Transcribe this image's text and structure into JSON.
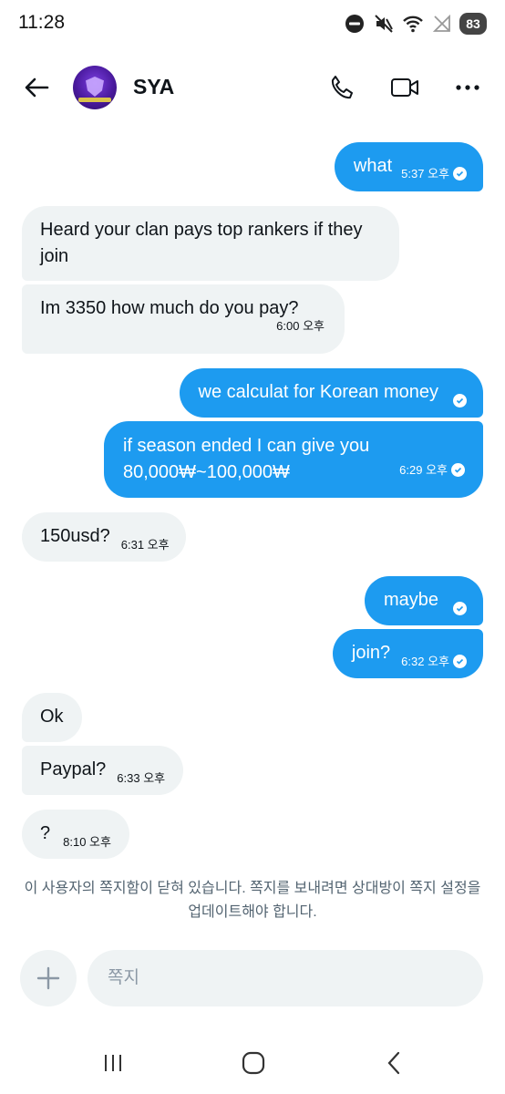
{
  "status_bar": {
    "time": "11:28",
    "battery": "83",
    "icons": [
      "do-not-disturb-icon",
      "mute-icon",
      "wifi-icon",
      "no-signal-icon",
      "battery-icon"
    ]
  },
  "header": {
    "contact_name": "SYA",
    "icons": [
      "back-arrow-icon",
      "phone-icon",
      "video-icon",
      "more-icon"
    ]
  },
  "messages": [
    {
      "side": "out",
      "text": "what",
      "time": "5:37 오후",
      "read": true
    },
    {
      "side": "in",
      "text": "Heard your clan pays top rankers if they join",
      "time": ""
    },
    {
      "side": "in",
      "text": "Im 3350 how much do you pay?",
      "time": "6:00 오후"
    },
    {
      "side": "out",
      "text": "we calculat for Korean money",
      "time": "",
      "read": true
    },
    {
      "side": "out",
      "text": "if season ended I can give you 80,000₩~100,000₩",
      "time": "6:29 오후",
      "read": true
    },
    {
      "side": "in",
      "text": "150usd?",
      "time": "6:31 오후"
    },
    {
      "side": "out",
      "text": "maybe",
      "time": "",
      "read": true
    },
    {
      "side": "out",
      "text": "join?",
      "time": "6:32 오후",
      "read": true
    },
    {
      "side": "in",
      "text": "Ok",
      "time": ""
    },
    {
      "side": "in",
      "text": "Paypal?",
      "time": "6:33 오후"
    },
    {
      "side": "in",
      "text": "?",
      "time": "8:10 오후"
    }
  ],
  "notice": "이 사용자의 쪽지함이 닫혀 있습니다. 쪽지를 보내려면 상대방이 쪽지 설정을 업데이트해야 합니다.",
  "composer": {
    "placeholder": "쪽지"
  },
  "colors": {
    "outgoing_bubble": "#1d9bf0",
    "incoming_bubble": "#eff3f4",
    "notice_text": "#536471"
  }
}
